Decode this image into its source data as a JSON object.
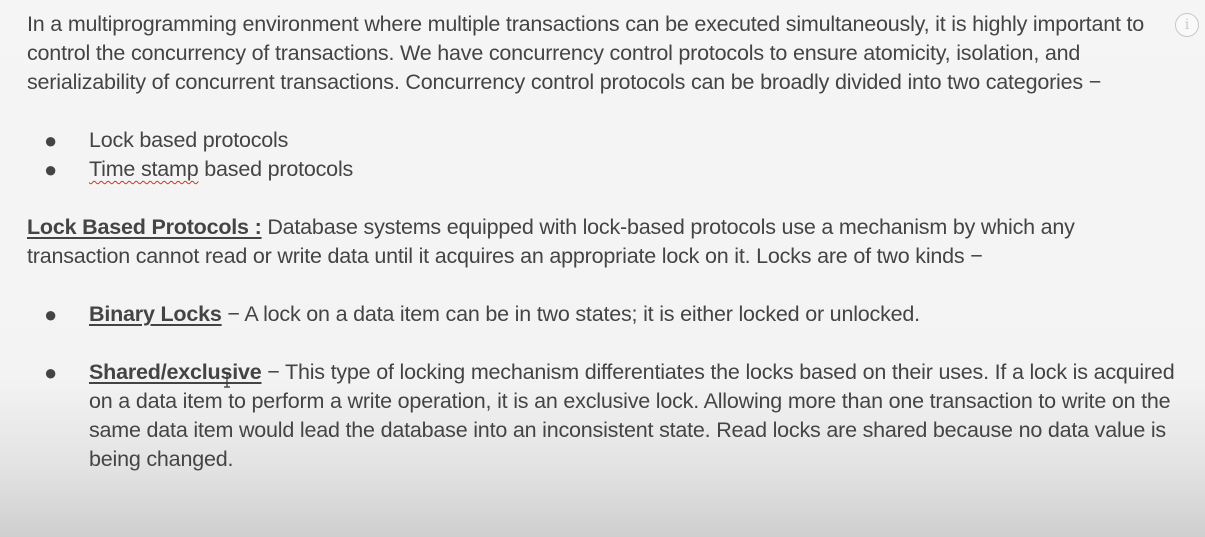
{
  "intro": "In a multiprogramming environment where multiple transactions can be executed simultaneously, it is highly important to control the concurrency of transactions. We have concurrency control protocols to ensure atomicity, isolation, and serializability of concurrent transactions. Concurrency control protocols can be broadly divided into two categories −",
  "categories": [
    {
      "bullet": "●",
      "text": "Lock based protocols"
    },
    {
      "bullet": "●",
      "text_marked": "Time stamp",
      "text_rest": " based protocols"
    }
  ],
  "lock_section": {
    "heading": "Lock Based Protocols :",
    "body": " Database systems equipped with lock-based protocols use a mechanism by which any transaction cannot read or write data until it acquires an appropriate lock on it. Locks are of two kinds −"
  },
  "lock_kinds": [
    {
      "bullet": "●",
      "term": "Binary Locks",
      "desc": " − A lock on a data item can be in two states; it is either locked or unlocked."
    },
    {
      "bullet": "●",
      "term": "Shared/exclusive",
      "desc": " − This type of locking mechanism differentiates the locks based on their uses. If a lock is acquired on a data item to perform a write operation, it is an exclusive lock. Allowing more than one transaction to write on the same data item would lead the database into an inconsistent state. Read locks are shared because no data value is being changed."
    }
  ],
  "icons": {
    "info": "info-icon",
    "cursor": "text-cursor-icon"
  },
  "info_glyph": "i",
  "colors": {
    "text": "#444444",
    "spellcheck_underline": "#c0392b",
    "background": "#f4f4f4"
  }
}
